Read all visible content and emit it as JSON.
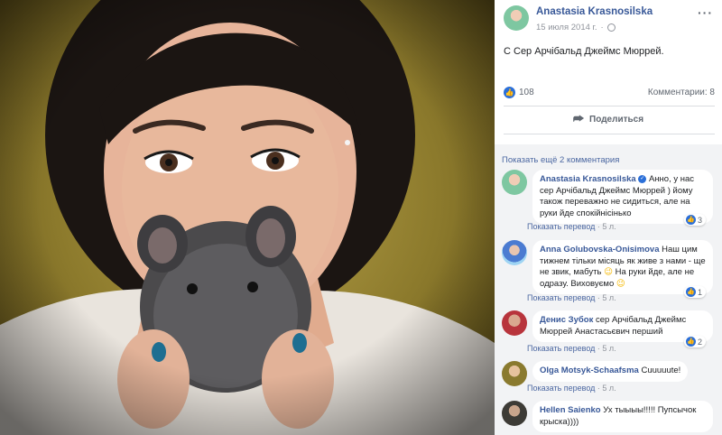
{
  "post": {
    "author": "Anastasia Krasnosilska",
    "date": "15 июля 2014 г.",
    "date_sep": "·",
    "text": "С Сер Арчібальд Джеймс Мюррей.",
    "likes": "108",
    "comments_count": "Комментарии: 8",
    "share_label": "Поделиться",
    "more_label": "···"
  },
  "comments_section": {
    "show_more": "Показать ещё 2 комментария",
    "translate_label": "Показать перевод",
    "dot": "·",
    "items": [
      {
        "name": "Anastasia Krasnosilska",
        "text": "Анно, у нас сер Арчібальд Джеймс Мюррей ) йому також переважно не сидиться, але на руки йде спокійнісінько",
        "time": "5 л.",
        "reactions": "3",
        "verified": true
      },
      {
        "name": "Anna Golubovska-Onisimova",
        "text": "Наш цим тижнем тільки місяць як живе з нами - ще не звик, мабуть 😉 На руки йде, але не одразу. Виховуємо 😉",
        "text_a": "Наш цим тижнем тільки місяць як живе з нами - ще не звик, мабуть",
        "text_b": "На руки йде, але не одразу. Виховуємо",
        "time": "5 л.",
        "reactions": "1"
      },
      {
        "name": "Денис Зубок",
        "text": "сер Арчібальд Джеймс Мюррей Анастасьєвич перший",
        "time": "5 л.",
        "reactions": "2"
      },
      {
        "name": "Olga Motsyk-Schaafsma",
        "text": "Cuuuuute!",
        "time": "5 л."
      },
      {
        "name": "Hellen Saienko",
        "text": "Ух тыыыы!!!!! Пупсычок крыска))))"
      }
    ]
  },
  "colors": {
    "link": "#385898",
    "like_blue": "#2b6fd8",
    "comment_bg": "#f2f3f5"
  }
}
